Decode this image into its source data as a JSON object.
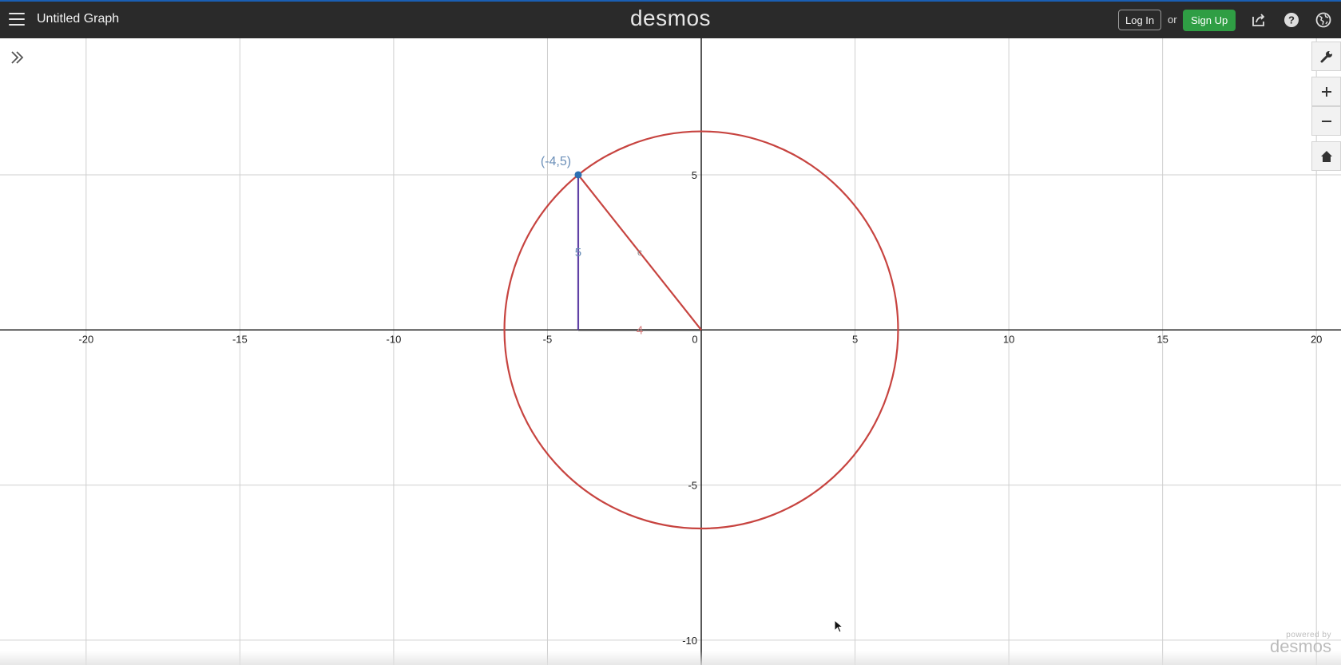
{
  "header": {
    "title": "Untitled Graph",
    "brand": "desmos",
    "login_label": "Log In",
    "or_label": "or",
    "signup_label": "Sign Up",
    "icons": [
      "menu-icon",
      "share-icon",
      "help-icon",
      "globe-icon"
    ]
  },
  "controls": {
    "icons": [
      "expand-list-icon",
      "wrench-icon",
      "zoom-in-icon",
      "zoom-out-icon",
      "home-icon"
    ]
  },
  "graph": {
    "x_ticks": [
      "-20",
      "-15",
      "-10",
      "-5",
      "0",
      "5",
      "10",
      "15",
      "20"
    ],
    "y_ticks": [
      "5",
      "-5",
      "-10"
    ],
    "point_label": "(-4,5)",
    "vertical_leg_label": "5",
    "horizontal_leg_label": "4",
    "hypotenuse_label": "c",
    "colors": {
      "circle": "#c74440",
      "leg_vertical": "#6042a6",
      "point": "#2d70b3",
      "label_blue": "#6b8fb8",
      "label_red": "#d98080"
    }
  },
  "chart_data": {
    "type": "scatter",
    "xlim": [
      -22.8,
      20.8
    ],
    "ylim": [
      -10.8,
      9.4
    ],
    "grid": true,
    "points": [
      {
        "x": -4,
        "y": 5,
        "label": "(-4,5)"
      }
    ],
    "segments": [
      {
        "from": [
          -4,
          0
        ],
        "to": [
          -4,
          5
        ],
        "label": "5"
      },
      {
        "from": [
          -4,
          0
        ],
        "to": [
          0,
          0
        ],
        "label": "4"
      },
      {
        "from": [
          -4,
          5
        ],
        "to": [
          0,
          0
        ],
        "label": "c"
      }
    ],
    "circle": {
      "center": [
        0,
        0
      ],
      "radius": 6.4
    }
  },
  "footer": {
    "powered_by": "powered by",
    "logo": "desmos"
  }
}
